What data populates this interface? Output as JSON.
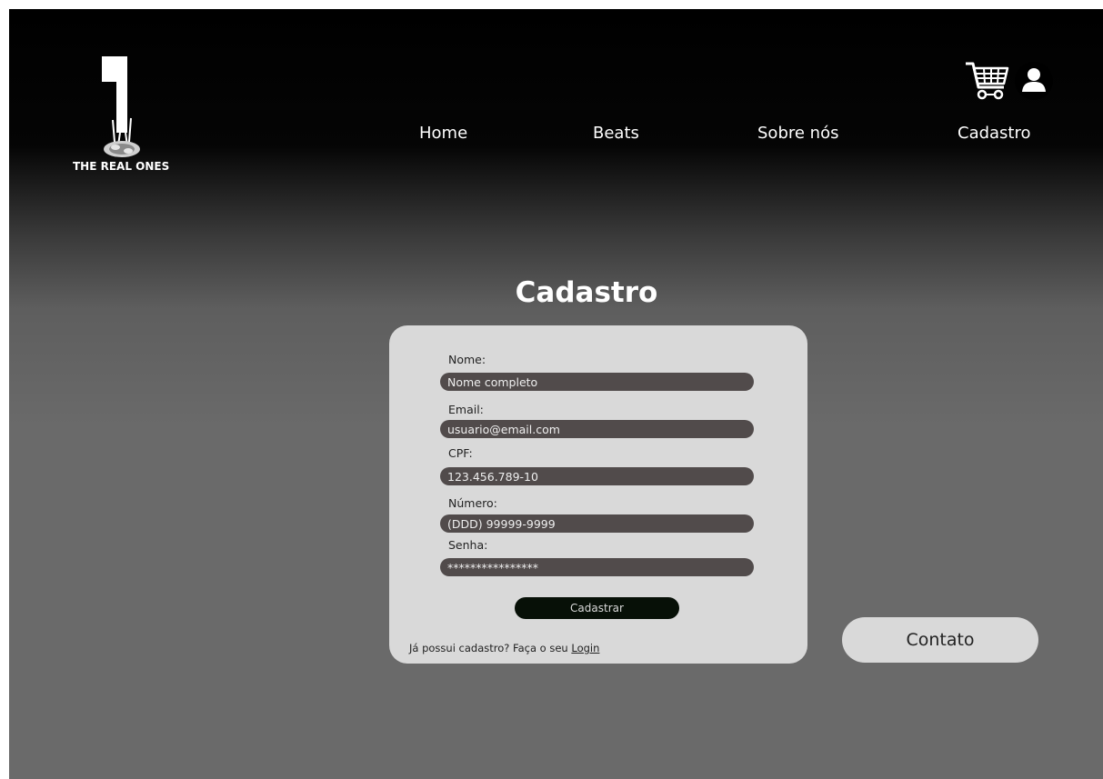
{
  "brand": {
    "logo_text": "THE REAL ONES"
  },
  "nav": {
    "items": [
      {
        "label": "Home"
      },
      {
        "label": "Beats"
      },
      {
        "label": "Sobre nós"
      },
      {
        "label": "Cadastro"
      }
    ]
  },
  "header_icons": {
    "cart": "shopping-cart-icon",
    "user": "user-profile-icon"
  },
  "form": {
    "title": "Cadastro",
    "fields": [
      {
        "label": "Nome:",
        "placeholder": "Nome completo"
      },
      {
        "label": "Email:",
        "placeholder": "usuario@email.com"
      },
      {
        "label": "CPF:",
        "placeholder": "123.456.789-10"
      },
      {
        "label": "Número:",
        "placeholder": "(DDD) 99999-9999"
      },
      {
        "label": "Senha:",
        "placeholder": "****************"
      }
    ],
    "submit_label": "Cadastrar",
    "login_prompt": "Já possui cadastro? Faça o seu",
    "login_link": "Login"
  },
  "contact": {
    "label": "Contato"
  },
  "colors": {
    "card_bg": "#d9d9d9",
    "input_bg": "#514b4b",
    "submit_bg": "#071007",
    "text_light": "#ffffff"
  }
}
